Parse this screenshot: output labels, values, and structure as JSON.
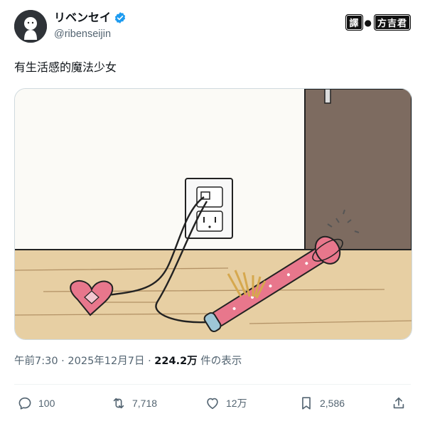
{
  "author": {
    "display_name": "リベンセイ",
    "handle": "@ribenseijin",
    "verified": true,
    "avatar_icon": "character-avatar-icon"
  },
  "badge": {
    "part1": "譯",
    "part2": "方吉君"
  },
  "tweet": {
    "text": "有生活感的魔法少女"
  },
  "meta": {
    "time": "午前7:30",
    "sep1": "·",
    "date": "2025年12月7日",
    "sep2": "·",
    "views": "224.2万",
    "views_label": "件の表示"
  },
  "actions": {
    "replies": "100",
    "reposts": "7,718",
    "likes": "12万",
    "bookmarks": "2,586"
  },
  "colors": {
    "verified": "#1d9bf0",
    "text_secondary": "#536471",
    "wand_pink": "#e8778c",
    "floor": "#e7cfa3",
    "door": "#7d6b60"
  }
}
